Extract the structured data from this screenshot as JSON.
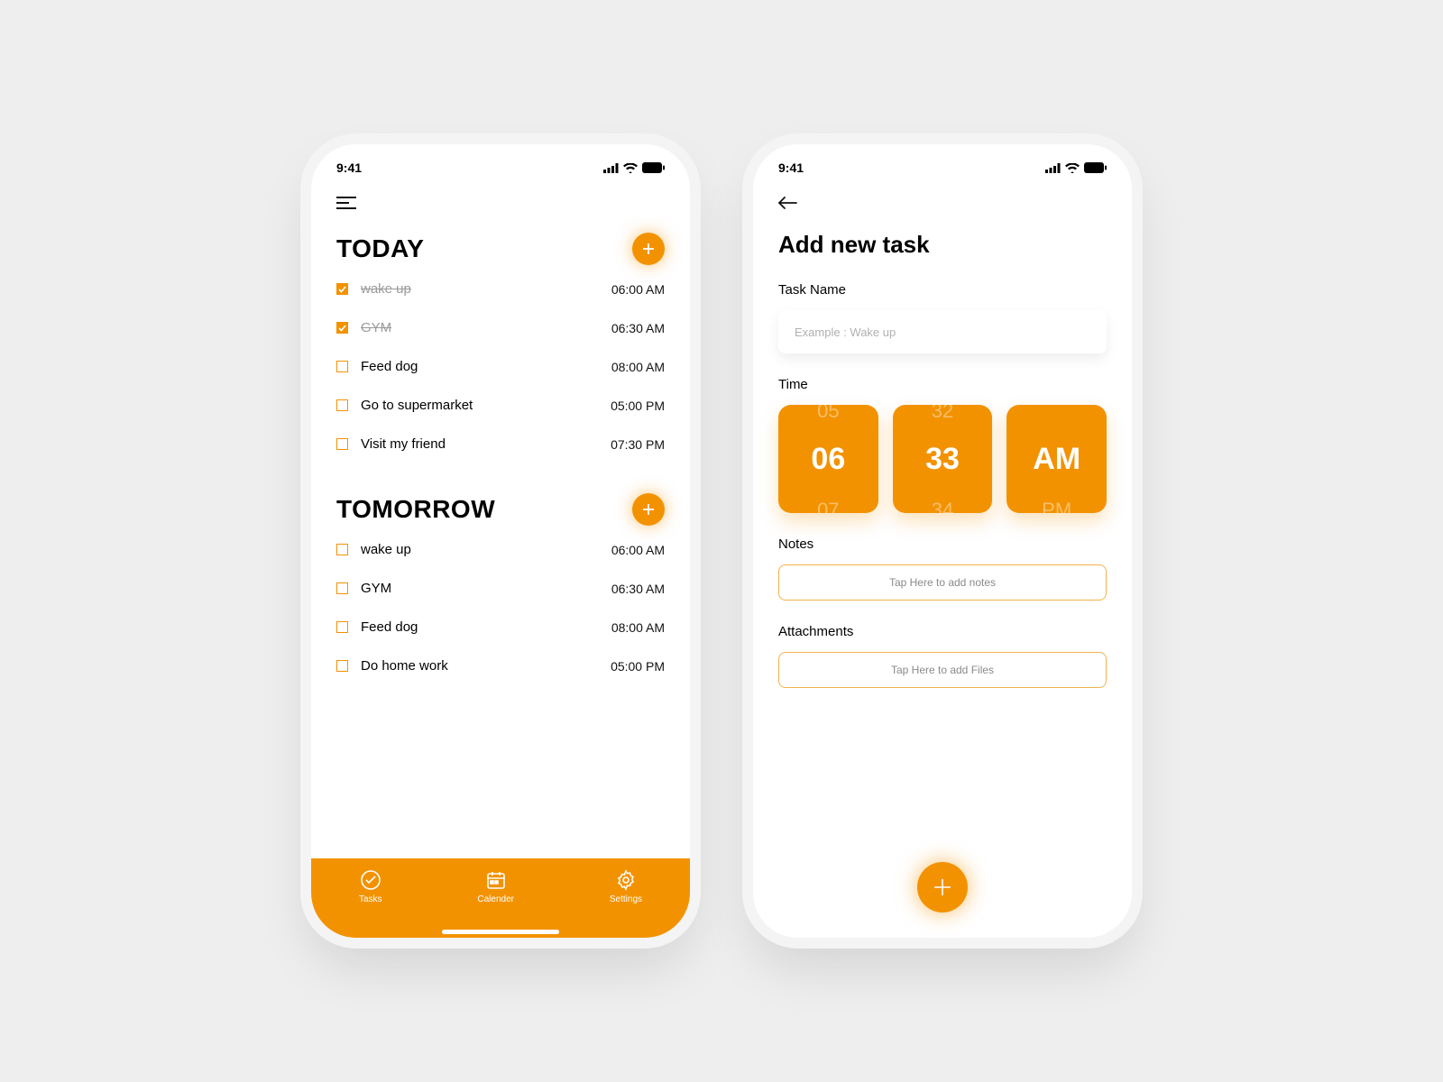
{
  "status": {
    "time": "9:41"
  },
  "screen1": {
    "sections": [
      {
        "title": "TODAY",
        "tasks": [
          {
            "label": "wake up",
            "time": "06:00 AM",
            "done": true
          },
          {
            "label": "GYM",
            "time": "06:30 AM",
            "done": true
          },
          {
            "label": "Feed dog",
            "time": "08:00 AM",
            "done": false
          },
          {
            "label": "Go to supermarket",
            "time": "05:00 PM",
            "done": false
          },
          {
            "label": "Visit my friend",
            "time": "07:30 PM",
            "done": false
          }
        ]
      },
      {
        "title": "TOMORROW",
        "tasks": [
          {
            "label": "wake up",
            "time": "06:00 AM",
            "done": false
          },
          {
            "label": "GYM",
            "time": "06:30 AM",
            "done": false
          },
          {
            "label": "Feed dog",
            "time": "08:00 AM",
            "done": false
          },
          {
            "label": "Do home work",
            "time": "05:00 PM",
            "done": false
          }
        ]
      }
    ],
    "tabs": {
      "tasks": "Tasks",
      "calendar": "Calender",
      "settings": "Settings"
    }
  },
  "screen2": {
    "title": "Add new task",
    "task_name_label": "Task Name",
    "task_name_placeholder": "Example : Wake up",
    "time_label": "Time",
    "picker": {
      "hour": {
        "prev": "05",
        "main": "06",
        "next": "07"
      },
      "minute": {
        "prev": "32",
        "main": "33",
        "next": "34"
      },
      "period": {
        "prev": "",
        "main": "AM",
        "next": "PM"
      }
    },
    "notes_label": "Notes",
    "notes_placeholder": "Tap Here to add notes",
    "attach_label": "Attachments",
    "attach_placeholder": "Tap Here to add Files"
  }
}
